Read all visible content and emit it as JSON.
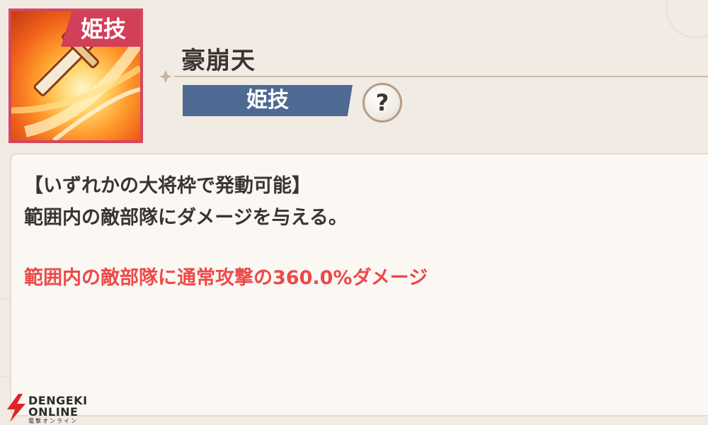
{
  "skill": {
    "icon_tag": "姫技",
    "name": "豪崩天",
    "type_label": "姫技",
    "help_label": "?"
  },
  "description": {
    "condition": "【いずれかの大将枠で発動可能】",
    "text": "範囲内の敵部隊にダメージを与える。",
    "effect": "範囲内の敵部隊に通常攻撃の360.0%ダメージ"
  },
  "watermark": {
    "line1": "DENGEKI",
    "line2": "ONLINE",
    "line3": "電撃オンライン"
  },
  "colors": {
    "icon_border": "#d4485e",
    "type_badge": "#4e6a92",
    "effect_text": "#ec4a4a",
    "background": "#f1ebe4",
    "panel": "#fbf8f4"
  },
  "icons": {
    "skill_icon": "sword-slash-icon",
    "help_icon": "question-icon"
  }
}
